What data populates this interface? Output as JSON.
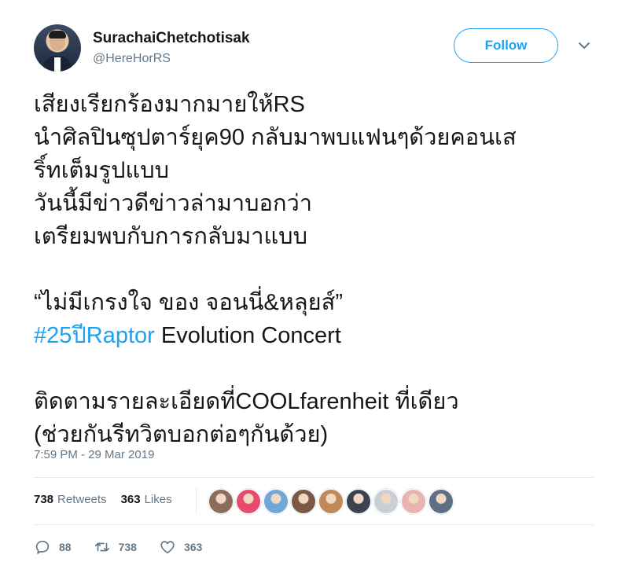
{
  "user": {
    "display_name": "SurachaiChetchotisak",
    "handle": "@HereHorRS"
  },
  "header": {
    "follow_label": "Follow",
    "menu_icon": "chevron-down-icon"
  },
  "tweet": {
    "lines": [
      "เสียงเรียกร้องมากมายให้RS",
      "นำศิลปินซุปตาร์ยุค90 กลับมาพบแฟนๆด้วยคอนเส",
      "ริ์ทเต็มรูปแบบ",
      "วันนี้มีข่าวดีข่าวล่ามาบอกว่า",
      "เตรียมพบกับการกลับมาแบบ",
      "",
      "“ไม่มีเกรงใจ ของ จอนนี่&หลุยส์”",
      "",
      "",
      "",
      "ติดตามรายละเอียดที่COOLfarenheit ที่เดียว",
      "(ช่วยกันรีทวิตบอกต่อๆกันด้วย)"
    ],
    "hashtag": "#25ปีRaptor",
    "hashtag_rest": " Evolution Concert",
    "timestamp": "7:59 PM - 29 Mar 2019"
  },
  "stats": {
    "retweets_count": "738",
    "retweets_label": "Retweets",
    "likes_count": "363",
    "likes_label": "Likes"
  },
  "likers": [
    {
      "color": "#8a6d5a"
    },
    {
      "color": "#e84a6b"
    },
    {
      "color": "#6fa7d8"
    },
    {
      "color": "#7a5a44"
    },
    {
      "color": "#c1885a"
    },
    {
      "color": "#3b4350"
    },
    {
      "color": "#c9cfd6"
    },
    {
      "color": "#e8b4b0"
    },
    {
      "color": "#5e6f86"
    }
  ],
  "actions": {
    "reply_count": "88",
    "retweet_count": "738",
    "like_count": "363"
  },
  "colors": {
    "accent": "#1da1f2",
    "secondary_text": "#657786",
    "primary_text": "#14171a"
  }
}
